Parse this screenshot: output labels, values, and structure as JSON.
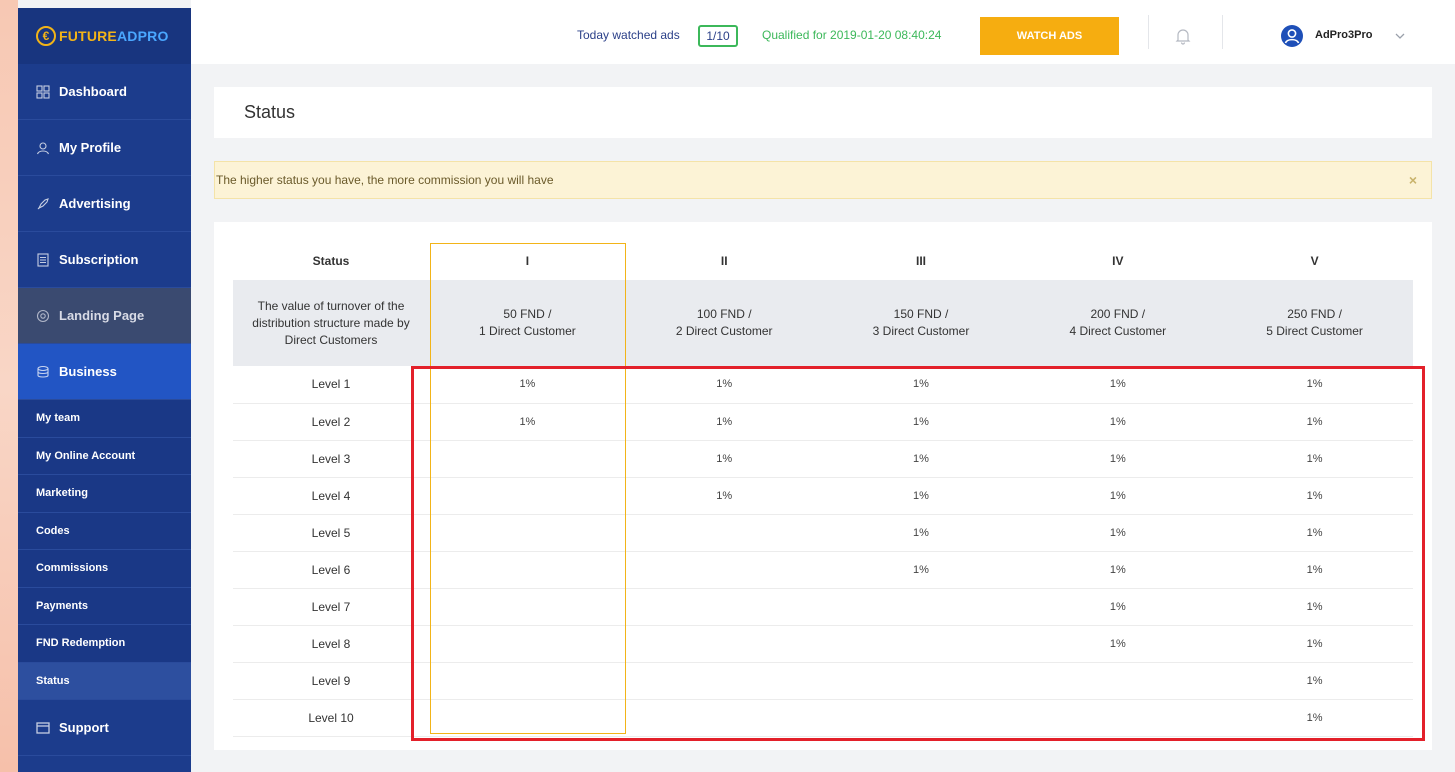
{
  "brand": {
    "logo_mark": "€",
    "logo_future": "FUTURE",
    "logo_adpro": "ADPRO"
  },
  "sidebar": {
    "items": [
      {
        "label": "Dashboard",
        "icon": "grid-icon"
      },
      {
        "label": "My Profile",
        "icon": "user-icon"
      },
      {
        "label": "Advertising",
        "icon": "rocket-icon"
      },
      {
        "label": "Subscription",
        "icon": "list-icon"
      },
      {
        "label": "Landing Page",
        "icon": "globe-icon"
      },
      {
        "label": "Business",
        "icon": "database-icon"
      }
    ],
    "sub_items": [
      "My team",
      "My Online Account",
      "Marketing",
      "Codes",
      "Commissions",
      "Payments",
      "FND Redemption",
      "Status"
    ],
    "support": {
      "label": "Support",
      "icon": "window-icon"
    }
  },
  "topbar": {
    "watched_label": "Today watched ads",
    "watched_count": "1/10",
    "qualified": "Qualified for 2019-01-20 08:40:24",
    "watch_button": "WATCH ADS",
    "username": "AdPro3Pro"
  },
  "page": {
    "title": "Status",
    "alert": "The higher status you have, the more commission you will have",
    "alert_close": "×"
  },
  "table": {
    "headers": [
      "Status",
      "I",
      "II",
      "III",
      "IV",
      "V"
    ],
    "value_row": {
      "label": "The value of turnover of the distribution structure made by Direct Customers",
      "values": [
        [
          "50 FND /",
          "1 Direct Customer"
        ],
        [
          "100 FND /",
          "2 Direct Customer"
        ],
        [
          "150 FND /",
          "3 Direct Customer"
        ],
        [
          "200 FND /",
          "4 Direct Customer"
        ],
        [
          "250 FND /",
          "5 Direct Customer"
        ]
      ]
    },
    "levels": [
      {
        "label": "Level 1",
        "cells": [
          "1%",
          "1%",
          "1%",
          "1%",
          "1%"
        ]
      },
      {
        "label": "Level 2",
        "cells": [
          "1%",
          "1%",
          "1%",
          "1%",
          "1%"
        ]
      },
      {
        "label": "Level 3",
        "cells": [
          "",
          "1%",
          "1%",
          "1%",
          "1%"
        ]
      },
      {
        "label": "Level 4",
        "cells": [
          "",
          "1%",
          "1%",
          "1%",
          "1%"
        ]
      },
      {
        "label": "Level 5",
        "cells": [
          "",
          "",
          "1%",
          "1%",
          "1%"
        ]
      },
      {
        "label": "Level 6",
        "cells": [
          "",
          "",
          "1%",
          "1%",
          "1%"
        ]
      },
      {
        "label": "Level 7",
        "cells": [
          "",
          "",
          "",
          "1%",
          "1%"
        ]
      },
      {
        "label": "Level 8",
        "cells": [
          "",
          "",
          "",
          "1%",
          "1%"
        ]
      },
      {
        "label": "Level 9",
        "cells": [
          "",
          "",
          "",
          "",
          "1%"
        ]
      },
      {
        "label": "Level 10",
        "cells": [
          "",
          "",
          "",
          "",
          "1%"
        ]
      }
    ]
  },
  "colors": {
    "sidebar": "#1c3c8c",
    "accent_orange": "#f6ad10",
    "accent_green": "#3cb85a",
    "highlight_red": "#e3202a",
    "highlight_yellow": "#f2b418"
  }
}
